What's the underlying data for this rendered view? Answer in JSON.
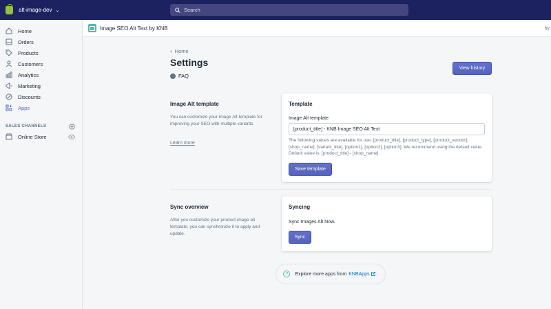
{
  "topbar": {
    "store_name": "alt-image-dev",
    "search_placeholder": "Search"
  },
  "sidebar": {
    "items": [
      {
        "label": "Home",
        "icon": "home-icon"
      },
      {
        "label": "Orders",
        "icon": "orders-icon"
      },
      {
        "label": "Products",
        "icon": "tag-icon"
      },
      {
        "label": "Customers",
        "icon": "person-icon"
      },
      {
        "label": "Analytics",
        "icon": "bar-chart-icon"
      },
      {
        "label": "Marketing",
        "icon": "megaphone-icon"
      },
      {
        "label": "Discounts",
        "icon": "discount-icon"
      },
      {
        "label": "Apps",
        "icon": "apps-icon",
        "active": true
      }
    ],
    "sales_channels_label": "SALES CHANNELS",
    "online_store_label": "Online Store"
  },
  "app_header": {
    "title": "Image SEO Alt Text by KNB",
    "right_text": "by"
  },
  "page": {
    "breadcrumb": "Home",
    "title": "Settings",
    "faq_label": "FAQ",
    "view_history_label": "View history"
  },
  "alt_section": {
    "title": "Image Alt template",
    "description": "You can customize your Image Alt template for improving your SEO with multiple variants.",
    "learn_more": "Learn more"
  },
  "template_card": {
    "title": "Template",
    "field_label": "Image Alt template",
    "field_value": "[product_title] - KNB Image SEO Alt Text",
    "help_text": "The following values are available for use: [product_title], [product_type], [product_vendor], [shop_name], [variant_title], [option1], [option2], [option3]. We recommend using the default value. Default value is: [product_title] - [shop_name].",
    "save_label": "Save template"
  },
  "sync_section": {
    "title": "Sync overview",
    "description": "After you customize your product image alt template, you can synchronize it to apply and update."
  },
  "sync_card": {
    "title": "Syncing",
    "text": "Sync Images Alt Now.",
    "sync_label": "Sync"
  },
  "footer": {
    "explore_text": "Explore more apps from",
    "link_text": "KNBApps",
    "suffix": "."
  },
  "colors": {
    "topbar": "#1c2260",
    "primary": "#5c6ac4",
    "accent": "#47c1a8",
    "link": "#006fbb"
  }
}
